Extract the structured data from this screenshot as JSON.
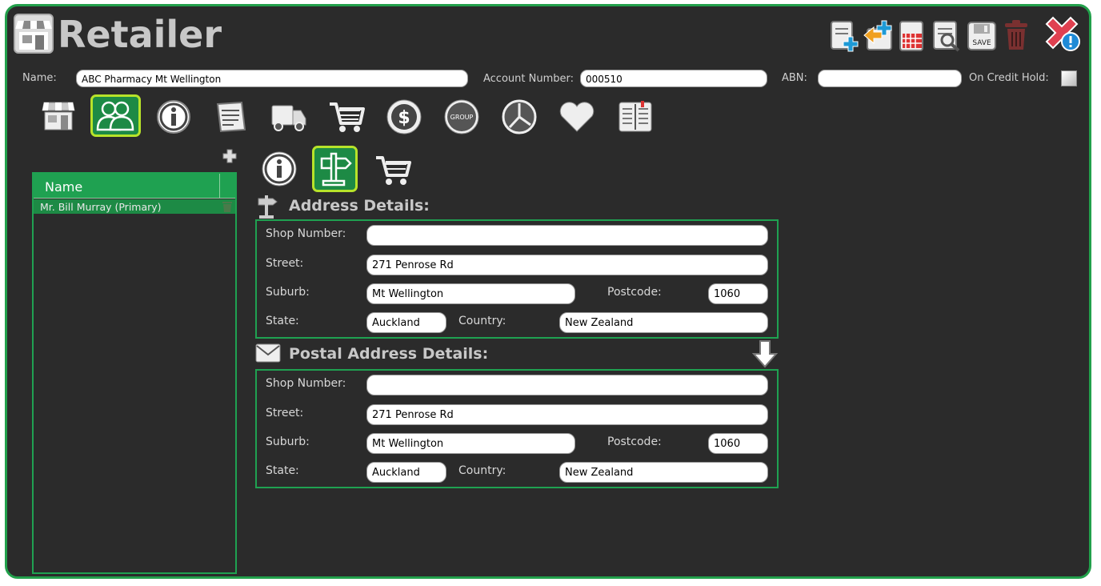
{
  "window": {
    "title": "Retailer"
  },
  "toolbar": {
    "icons": [
      "add-note-icon",
      "import-icon",
      "calendar-icon",
      "inspect-icon",
      "save-icon",
      "delete-icon",
      "close-alert-icon"
    ],
    "save_text": "SAVE"
  },
  "header_fields": {
    "name_label": "Name:",
    "name_value": "ABC Pharmacy Mt Wellington",
    "account_label": "Account Number:",
    "account_value": "000510",
    "abn_label": "ABN:",
    "abn_value": "",
    "credit_hold_label": "On Credit Hold:"
  },
  "nav_tabs": {
    "items": [
      "store",
      "contacts",
      "info",
      "notes",
      "delivery",
      "orders",
      "payments",
      "group",
      "reports",
      "favourites",
      "catalogue"
    ],
    "active": "contacts",
    "group_text": "GROUP"
  },
  "contacts": {
    "column_header": "Name",
    "rows": [
      "Mr. Bill Murray (Primary)"
    ]
  },
  "sub_tabs": {
    "items": [
      "info",
      "address",
      "cart"
    ],
    "active": "address"
  },
  "address": {
    "title": "Address Details:",
    "shop_label": "Shop Number:",
    "shop_value": "",
    "street_label": "Street:",
    "street_value": "271 Penrose Rd",
    "suburb_label": "Suburb:",
    "suburb_value": "Mt Wellington",
    "postcode_label": "Postcode:",
    "postcode_value": "1060",
    "state_label": "State:",
    "state_value": "Auckland",
    "country_label": "Country:",
    "country_value": "New Zealand"
  },
  "postal": {
    "title": "Postal Address Details:",
    "shop_label": "Shop Number:",
    "shop_value": "",
    "street_label": "Street:",
    "street_value": "271 Penrose Rd",
    "suburb_label": "Suburb:",
    "suburb_value": "Mt Wellington",
    "postcode_label": "Postcode:",
    "postcode_value": "1060",
    "state_label": "State:",
    "state_value": "Auckland",
    "country_label": "Country:",
    "country_value": "New Zealand"
  },
  "colors": {
    "accent": "#22a04b",
    "highlight": "#b7e32a",
    "background": "#2b2b2b"
  }
}
